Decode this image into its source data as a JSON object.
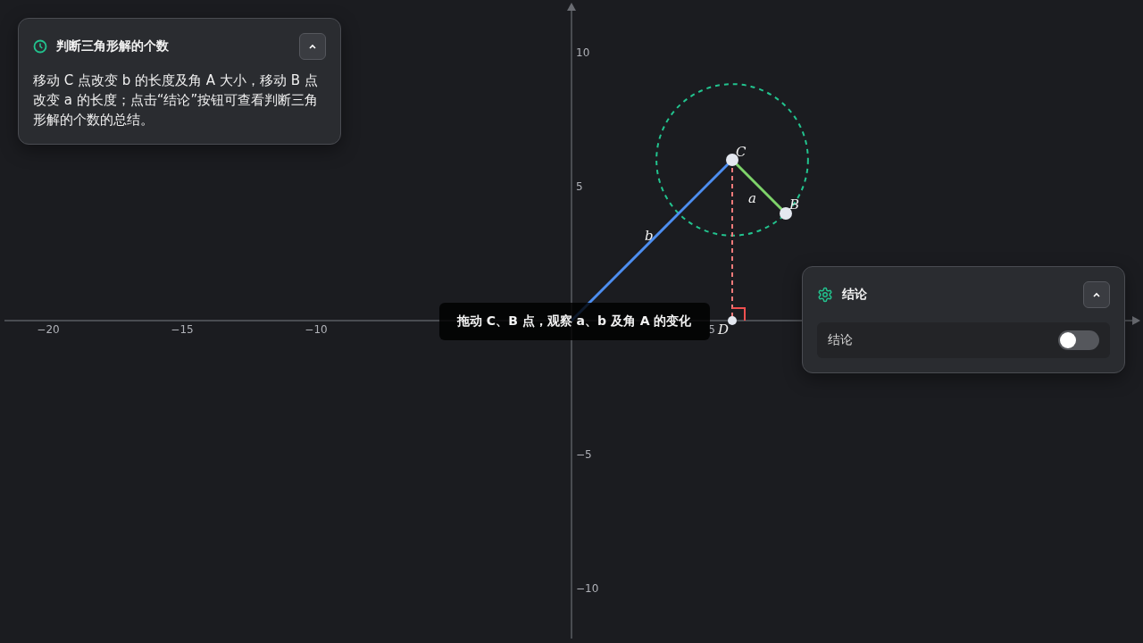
{
  "info_panel": {
    "title": "判断三角形解的个数",
    "expanded": true,
    "description": "移动 C 点改变 b 的长度及角 A 大小，移动 B 点改变 a 的长度；点击“结论”按钮可查看判断三角形解的个数的总结。"
  },
  "graph": {
    "x_ticks": [
      "−20",
      "−15",
      "−10",
      "5"
    ],
    "y_ticks": [
      "10",
      "5",
      "−5",
      "−10"
    ],
    "points": [
      {
        "name": "C"
      },
      {
        "name": "B"
      },
      {
        "name": "D"
      }
    ],
    "side_labels": [
      {
        "kind": "b",
        "text": "b"
      },
      {
        "kind": "a",
        "text": "a"
      }
    ]
  },
  "hint": "拖动 C、B 点，观察 a、b 及角 A 的变化",
  "conclusion_panel": {
    "title": "结论",
    "expanded": true,
    "items": [
      {
        "label": "结论",
        "on": false
      }
    ]
  }
}
